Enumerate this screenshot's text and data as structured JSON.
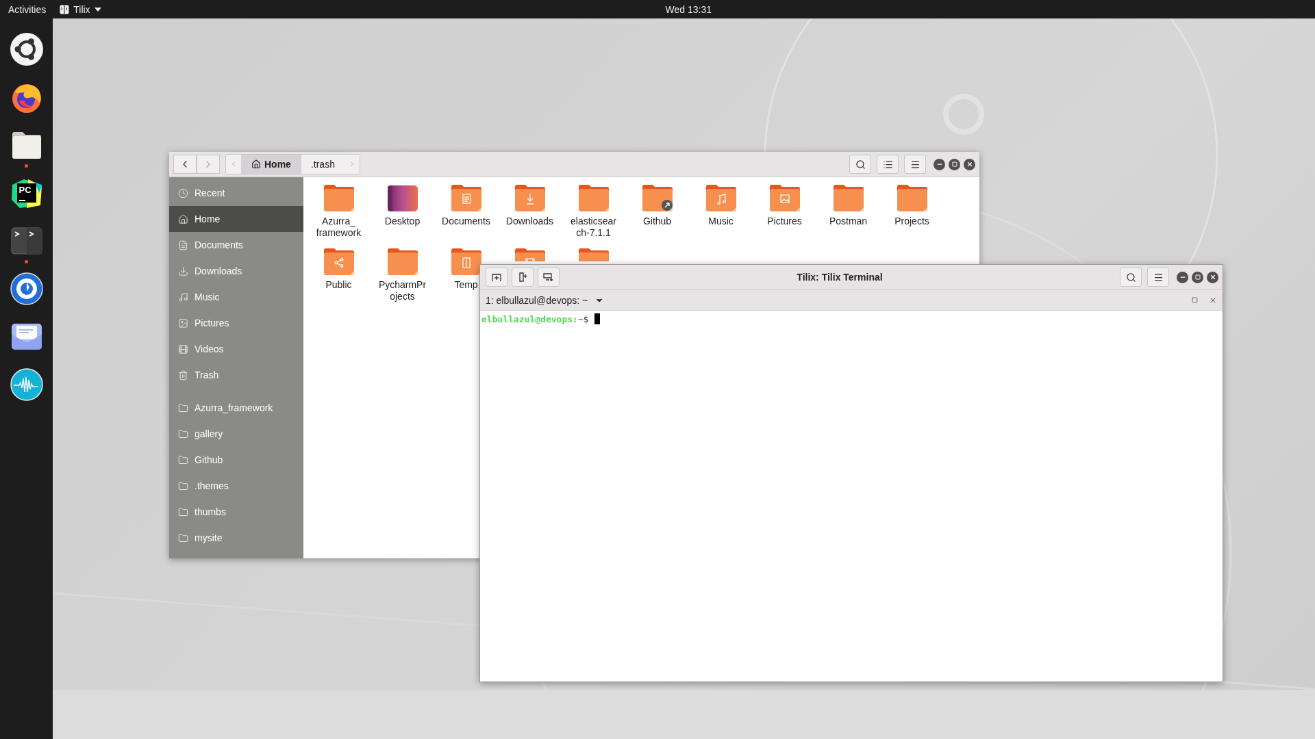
{
  "top_bar": {
    "activities": "Activities",
    "app_menu": "Tilix",
    "clock": "Wed 13:31"
  },
  "dock": [
    {
      "kind": "ubuntu",
      "running": false
    },
    {
      "kind": "browser",
      "running": false
    },
    {
      "kind": "files",
      "running": true
    },
    {
      "kind": "ide",
      "running": false,
      "text": "PC"
    },
    {
      "kind": "terminal",
      "running": true
    },
    {
      "kind": "chat",
      "running": false
    },
    {
      "kind": "mail",
      "running": false
    },
    {
      "kind": "audio",
      "running": false
    }
  ],
  "file_manager": {
    "path": [
      {
        "label": "Home",
        "kind": "home",
        "selected": true
      },
      {
        "label": ".trash",
        "kind": "plain",
        "selected": false
      }
    ],
    "places": [
      {
        "label": "Recent",
        "kind": "recent",
        "selected": false
      },
      {
        "label": "Home",
        "kind": "home",
        "selected": true
      },
      {
        "label": "Documents",
        "kind": "documents",
        "selected": false
      },
      {
        "label": "Downloads",
        "kind": "downloads",
        "selected": false
      },
      {
        "label": "Music",
        "kind": "music",
        "selected": false
      },
      {
        "label": "Pictures",
        "kind": "pictures",
        "selected": false
      },
      {
        "label": "Videos",
        "kind": "videos",
        "selected": false
      },
      {
        "label": "Trash",
        "kind": "trash",
        "selected": false
      }
    ],
    "bookmarks": [
      {
        "label": "Azurra_framework",
        "selected": false
      },
      {
        "label": "gallery",
        "selected": false
      },
      {
        "label": "Github",
        "selected": false
      },
      {
        "label": ".themes",
        "selected": false
      },
      {
        "label": "thumbs",
        "selected": false
      },
      {
        "label": "mysite",
        "selected": false
      }
    ],
    "items": [
      {
        "label": "Azurra_ framework",
        "kind": "plain"
      },
      {
        "label": "Desktop",
        "kind": "desktop"
      },
      {
        "label": "Documents",
        "kind": "documents"
      },
      {
        "label": "Downloads",
        "kind": "downloads"
      },
      {
        "label": "elasticsear ch-7.1.1",
        "kind": "plain"
      },
      {
        "label": "Github",
        "kind": "link"
      },
      {
        "label": "Music",
        "kind": "music"
      },
      {
        "label": "Pictures",
        "kind": "pictures"
      },
      {
        "label": "Postman",
        "kind": "plain"
      },
      {
        "label": "Projects",
        "kind": "plain"
      },
      {
        "label": "Public",
        "kind": "public"
      },
      {
        "label": "PycharmPr ojects",
        "kind": "plain"
      },
      {
        "label": "Temp",
        "kind": "templates"
      },
      {
        "kind": "videos"
      },
      {
        "kind": "plain"
      }
    ]
  },
  "terminal": {
    "title": "Tilix: Tilix Terminal",
    "session": "1: elbullazul@devops: ~",
    "prompt_user": "elbullazul@devops",
    "prompt_sep": ":",
    "prompt_path": "~",
    "prompt_symbol": "$"
  }
}
